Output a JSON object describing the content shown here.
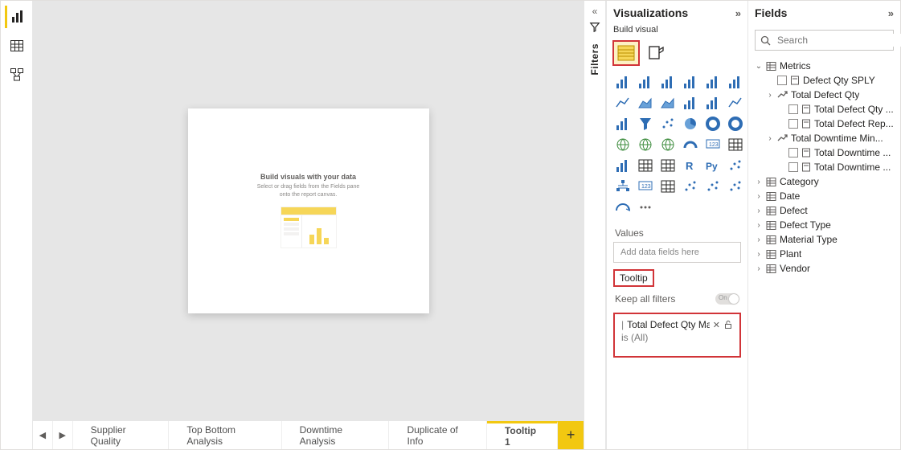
{
  "leftbar": {
    "tools": [
      "report-view",
      "data-view",
      "model-view"
    ]
  },
  "canvas": {
    "hint_title": "Build visuals with your data",
    "hint_sub": "Select or drag fields from the Fields pane onto the report canvas."
  },
  "tabs": {
    "items": [
      "Supplier Quality",
      "Top Bottom Analysis",
      "Downtime Analysis",
      "Duplicate of Info",
      "Tooltip 1"
    ],
    "active_index": 4
  },
  "filters_pane": {
    "label": "Filters"
  },
  "viz": {
    "title": "Visualizations",
    "sub": "Build visual",
    "values_label": "Values",
    "values_placeholder": "Add data fields here",
    "tooltip_label": "Tooltip",
    "keep_filters_label": "Keep all filters",
    "toggle_text": "On",
    "card": {
      "name": "Total Defect Qty Max",
      "sub": "is (All)"
    },
    "visual_icons": [
      "stacked-bar",
      "stacked-column",
      "clustered-bar",
      "clustered-column",
      "100-stacked-bar",
      "100-stacked-column",
      "line",
      "area",
      "stacked-area",
      "line-stacked-column",
      "line-clustered-column",
      "ribbon",
      "waterfall",
      "funnel",
      "scatter",
      "pie",
      "donut",
      "treemap",
      "map",
      "filled-map",
      "azure-map",
      "gauge",
      "card",
      "multi-row-card",
      "kpi",
      "table",
      "matrix",
      "r-visual",
      "py-visual",
      "key-influencers",
      "decomposition-tree",
      "qna",
      "paginated",
      "smart-narrative",
      "metrics",
      "custom-visual",
      "arcgis",
      "more"
    ]
  },
  "fields": {
    "title": "Fields",
    "search_placeholder": "Search",
    "tree": {
      "metrics": {
        "label": "Metrics",
        "children": [
          {
            "label": "Defect Qty SPLY",
            "icon": "calc",
            "check": true
          },
          {
            "label": "Total Defect Qty",
            "icon": "trend",
            "expandable": true,
            "children": [
              {
                "label": "Total Defect Qty ...",
                "icon": "calc",
                "check": true
              },
              {
                "label": "Total Defect Rep...",
                "icon": "calc",
                "check": true
              }
            ]
          },
          {
            "label": "Total Downtime Min...",
            "icon": "trend",
            "expandable": true,
            "children": [
              {
                "label": "Total Downtime ...",
                "icon": "calc",
                "check": true
              },
              {
                "label": "Total Downtime ...",
                "icon": "calc",
                "check": true
              }
            ]
          }
        ]
      },
      "tables": [
        "Category",
        "Date",
        "Defect",
        "Defect Type",
        "Material Type",
        "Plant",
        "Vendor"
      ]
    }
  }
}
